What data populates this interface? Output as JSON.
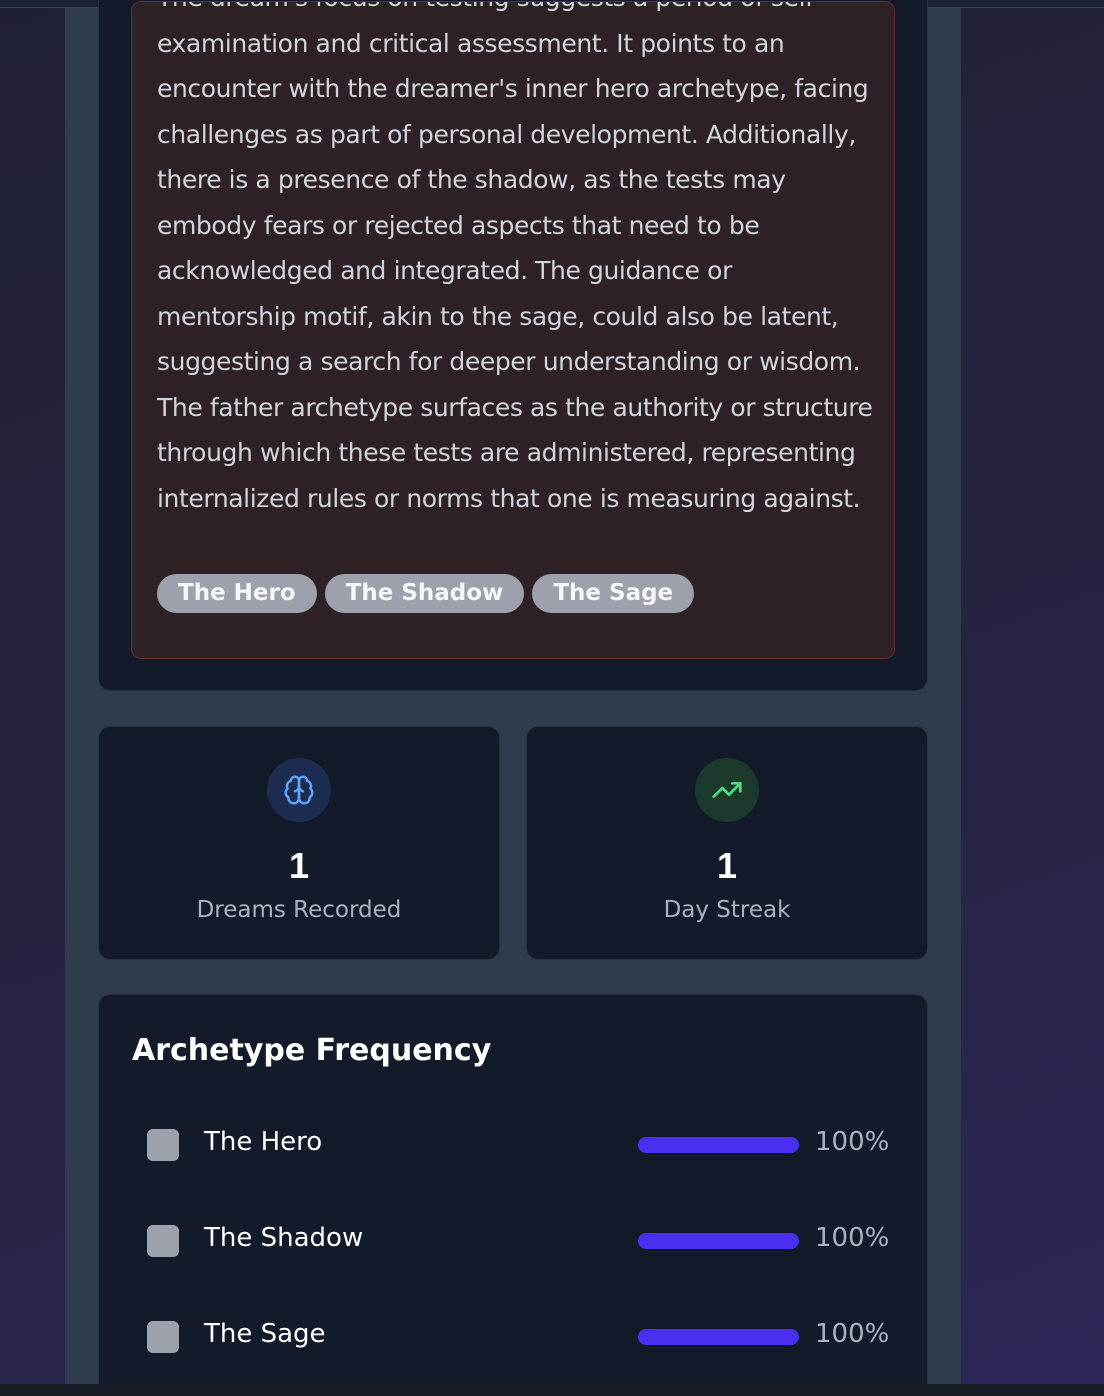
{
  "interpretation": {
    "text": "The dream's focus on testing suggests a period of self-examination and critical assessment. It points to an encounter with the dreamer's inner hero archetype, facing challenges as part of personal development. Additionally, there is a presence of the shadow, as the tests may embody fears or rejected aspects that need to be acknowledged and integrated. The guidance or mentorship motif, akin to the sage, could also be latent, suggesting a search for deeper understanding or wisdom. The father archetype surfaces as the authority or structure through which these tests are administered, representing internalized rules or norms that one is measuring against.",
    "tags": [
      "The Hero",
      "The Shadow",
      "The Sage"
    ]
  },
  "stats": {
    "dreams": {
      "value": "1",
      "label": "Dreams Recorded",
      "icon": "brain-icon",
      "color": "#60a5fa"
    },
    "streak": {
      "value": "1",
      "label": "Day Streak",
      "icon": "trending-up-icon",
      "color": "#4ade80"
    }
  },
  "frequency": {
    "title": "Archetype Frequency",
    "bar_color": "#4b2ff0",
    "items": [
      {
        "name": "The Hero",
        "percent_label": "100%",
        "fraction": 1.0
      },
      {
        "name": "The Shadow",
        "percent_label": "100%",
        "fraction": 1.0
      },
      {
        "name": "The Sage",
        "percent_label": "100%",
        "fraction": 1.0
      }
    ]
  }
}
